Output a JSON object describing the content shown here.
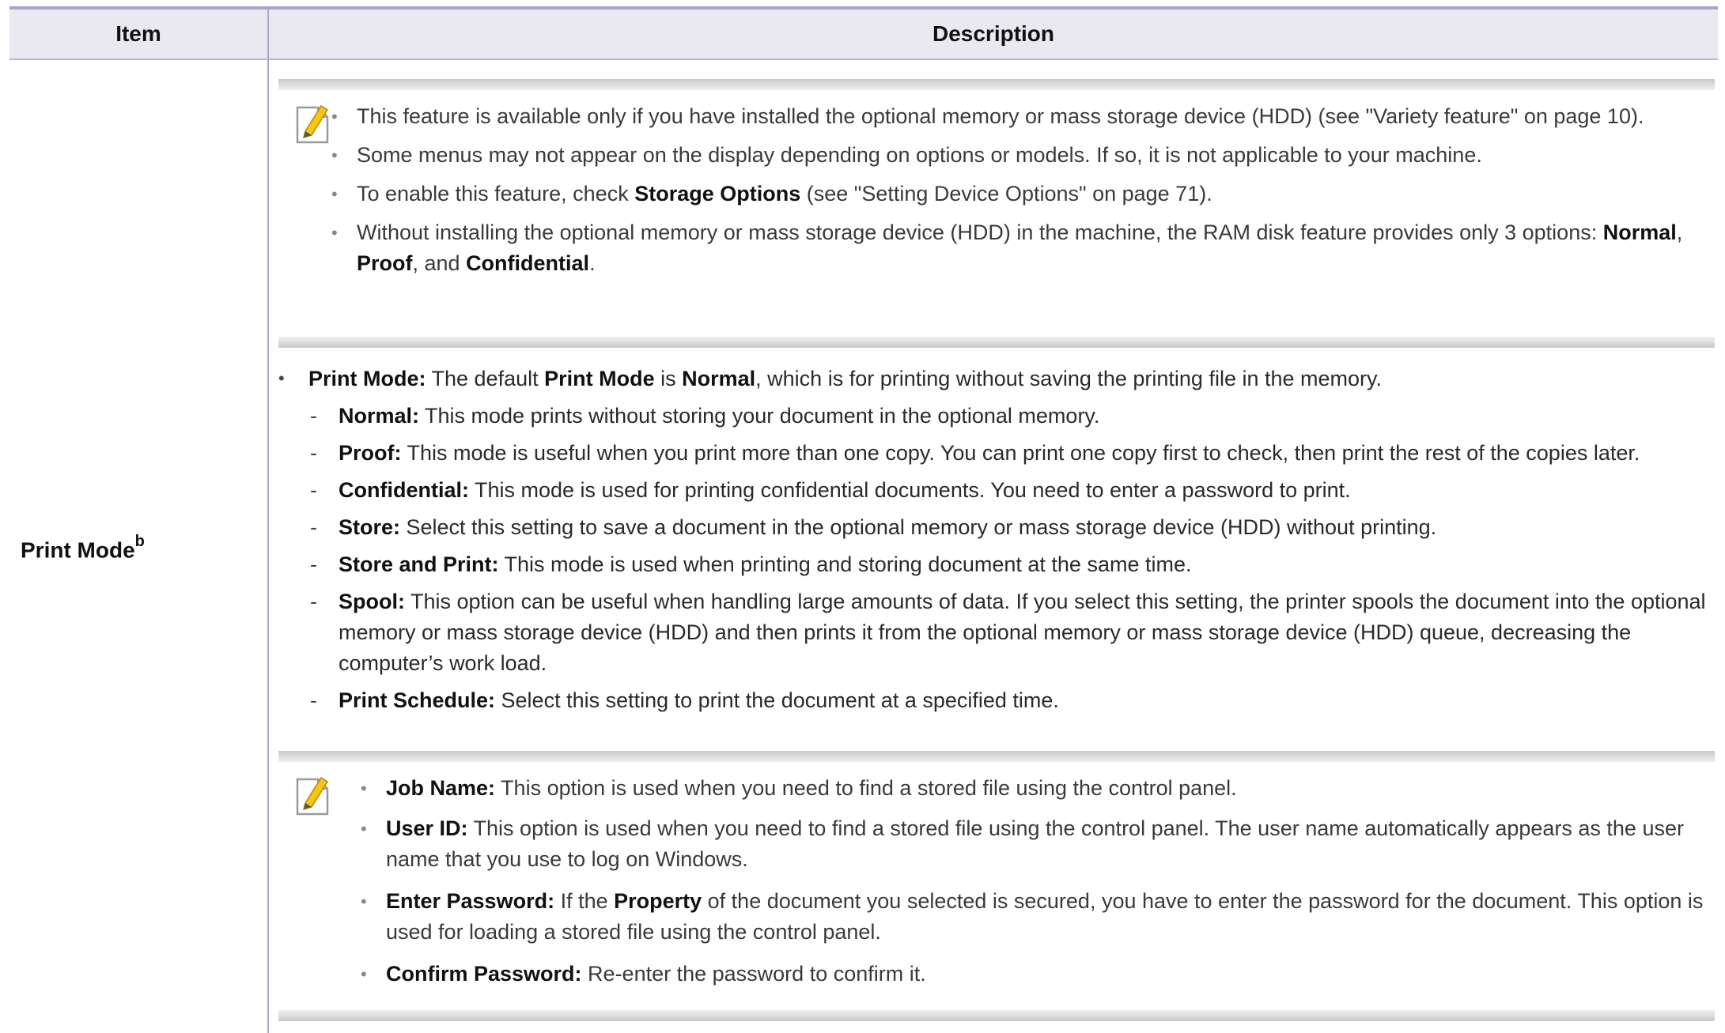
{
  "header": {
    "item": "Item",
    "description": "Description"
  },
  "item_label": "Print Mode",
  "item_sup": "b",
  "note1": {
    "icon": "note-pencil-icon",
    "bullets": [
      {
        "text": " This feature is available only if you have installed the optional memory or mass storage device (HDD) (see \"Variety feature\" on page 10)."
      },
      {
        "text": "Some menus may not appear on the display depending on options or models. If so, it is not applicable to your machine."
      },
      {
        "pre": "To enable this feature, check ",
        "bold": "Storage Options",
        "post": " (see \"Setting Device Options\" on page 71)."
      },
      {
        "text": "Without installing the optional memory or mass storage device (HDD) in the machine, the RAM disk feature provides only 3 options: ",
        "b1": "Normal",
        "s1": ", ",
        "b2": "Proof",
        "s2": ", and ",
        "b3": "Confidential",
        "s3": "."
      }
    ]
  },
  "print_mode": {
    "head": {
      "b1": "Print Mode:",
      "t1": " The default ",
      "b2": "Print Mode",
      "t2": " is ",
      "b3": "Normal",
      "t3": ", which is for printing without saving the printing file in the memory."
    },
    "options": [
      {
        "name": "Normal:",
        "text": " This mode prints without storing your document in the optional memory."
      },
      {
        "name": "Proof:",
        "text": " This mode is useful when you print more than one copy. You can print one copy first to check, then print the rest of the copies later."
      },
      {
        "name": "Confidential:",
        "text": " This mode is used for printing confidential documents. You need to enter a password to print."
      },
      {
        "name": "Store:",
        "text": " Select this setting to save a document in the optional memory or mass storage device (HDD) without printing."
      },
      {
        "name": "Store and Print:",
        "text": " This mode is used when printing and storing document at the same time."
      },
      {
        "name": "Spool:",
        "text": " This option can be useful when handling large amounts of data. If you select this setting, the printer spools the document into the optional memory or mass storage device (HDD) and then prints it from the optional memory or mass storage device (HDD) queue, decreasing the computer’s work load."
      },
      {
        "name": "Print Schedule:",
        "text": " Select this setting to print the document at a specified time."
      }
    ]
  },
  "note2": {
    "icon": "note-pencil-icon",
    "bullets": [
      {
        "name": "Job Name:",
        "text": " This option is used when you need to find a stored file using the control panel."
      },
      {
        "name": "User ID:",
        "text": " This option is used when you need to find a stored file using the control panel. The user name automatically appears as the user name that you use to log on Windows."
      },
      {
        "name": "Enter Password:",
        "pre": " If the ",
        "bold": "Property",
        "text": " of the document you selected is secured, you have to enter the password for the document.  This option is used for loading a stored file using the control panel."
      },
      {
        "name": "Confirm Password:",
        "text": " Re-enter the password to confirm it."
      }
    ]
  },
  "bullet_char": "•",
  "dash_char": "-"
}
